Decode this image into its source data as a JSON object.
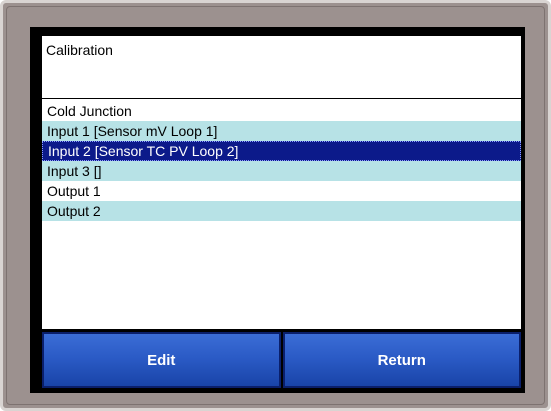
{
  "header": {
    "title": "Calibration"
  },
  "list": {
    "items": [
      {
        "label": "Cold Junction"
      },
      {
        "label": "Input 1 [Sensor mV  Loop 1]"
      },
      {
        "label": "Input 2 [Sensor TC PV Loop 2]"
      },
      {
        "label": "Input 3 []"
      },
      {
        "label": "Output 1"
      },
      {
        "label": "Output 2"
      }
    ],
    "selected_index": 2
  },
  "buttons": {
    "edit_label": "Edit",
    "return_label": "Return"
  },
  "colors": {
    "bezel": "#9c918f",
    "row_alt": "#b7e2e6",
    "row_selected": "#0c1a8a",
    "button": "#2b5bc6"
  }
}
